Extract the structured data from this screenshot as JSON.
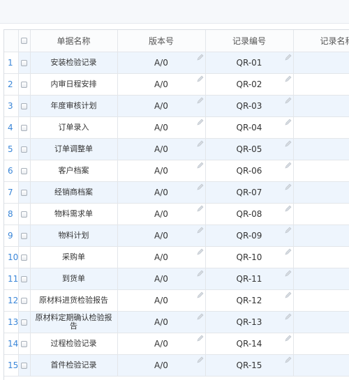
{
  "grid": {
    "columns": [
      "单据名称",
      "版本号",
      "记录编号",
      "记录名称"
    ],
    "rows": [
      {
        "num": "1",
        "name": "安装检验记录",
        "version": "A/0",
        "code": "QR-01"
      },
      {
        "num": "2",
        "name": "内审日程安排",
        "version": "A/0",
        "code": "QR-02"
      },
      {
        "num": "3",
        "name": "年度审核计划",
        "version": "A/0",
        "code": "QR-03"
      },
      {
        "num": "4",
        "name": "订单录入",
        "version": "A/0",
        "code": "QR-04"
      },
      {
        "num": "5",
        "name": "订单调整单",
        "version": "A/0",
        "code": "QR-05"
      },
      {
        "num": "6",
        "name": "客户档案",
        "version": "A/0",
        "code": "QR-06"
      },
      {
        "num": "7",
        "name": "经销商档案",
        "version": "A/0",
        "code": "QR-07"
      },
      {
        "num": "8",
        "name": "物料需求单",
        "version": "A/0",
        "code": "QR-08"
      },
      {
        "num": "9",
        "name": "物料计划",
        "version": "A/0",
        "code": "QR-09"
      },
      {
        "num": "10",
        "name": "采购单",
        "version": "A/0",
        "code": "QR-10"
      },
      {
        "num": "11",
        "name": "到货单",
        "version": "A/0",
        "code": "QR-11"
      },
      {
        "num": "12",
        "name": "原材料进货检验报告",
        "version": "A/0",
        "code": "QR-12"
      },
      {
        "num": "13",
        "name": "原材料定期确认检验报告",
        "version": "A/0",
        "code": "QR-13"
      },
      {
        "num": "14",
        "name": "过程检验记录",
        "version": "A/0",
        "code": "QR-14"
      },
      {
        "num": "15",
        "name": "首件检验记录",
        "version": "A/0",
        "code": "QR-15"
      }
    ]
  },
  "icons": {
    "checkbox": "checkbox-icon",
    "edit": "pencil-edit-icon"
  },
  "colors": {
    "row_number": "#3a86d8",
    "row_stripe": "#eef5fd"
  }
}
